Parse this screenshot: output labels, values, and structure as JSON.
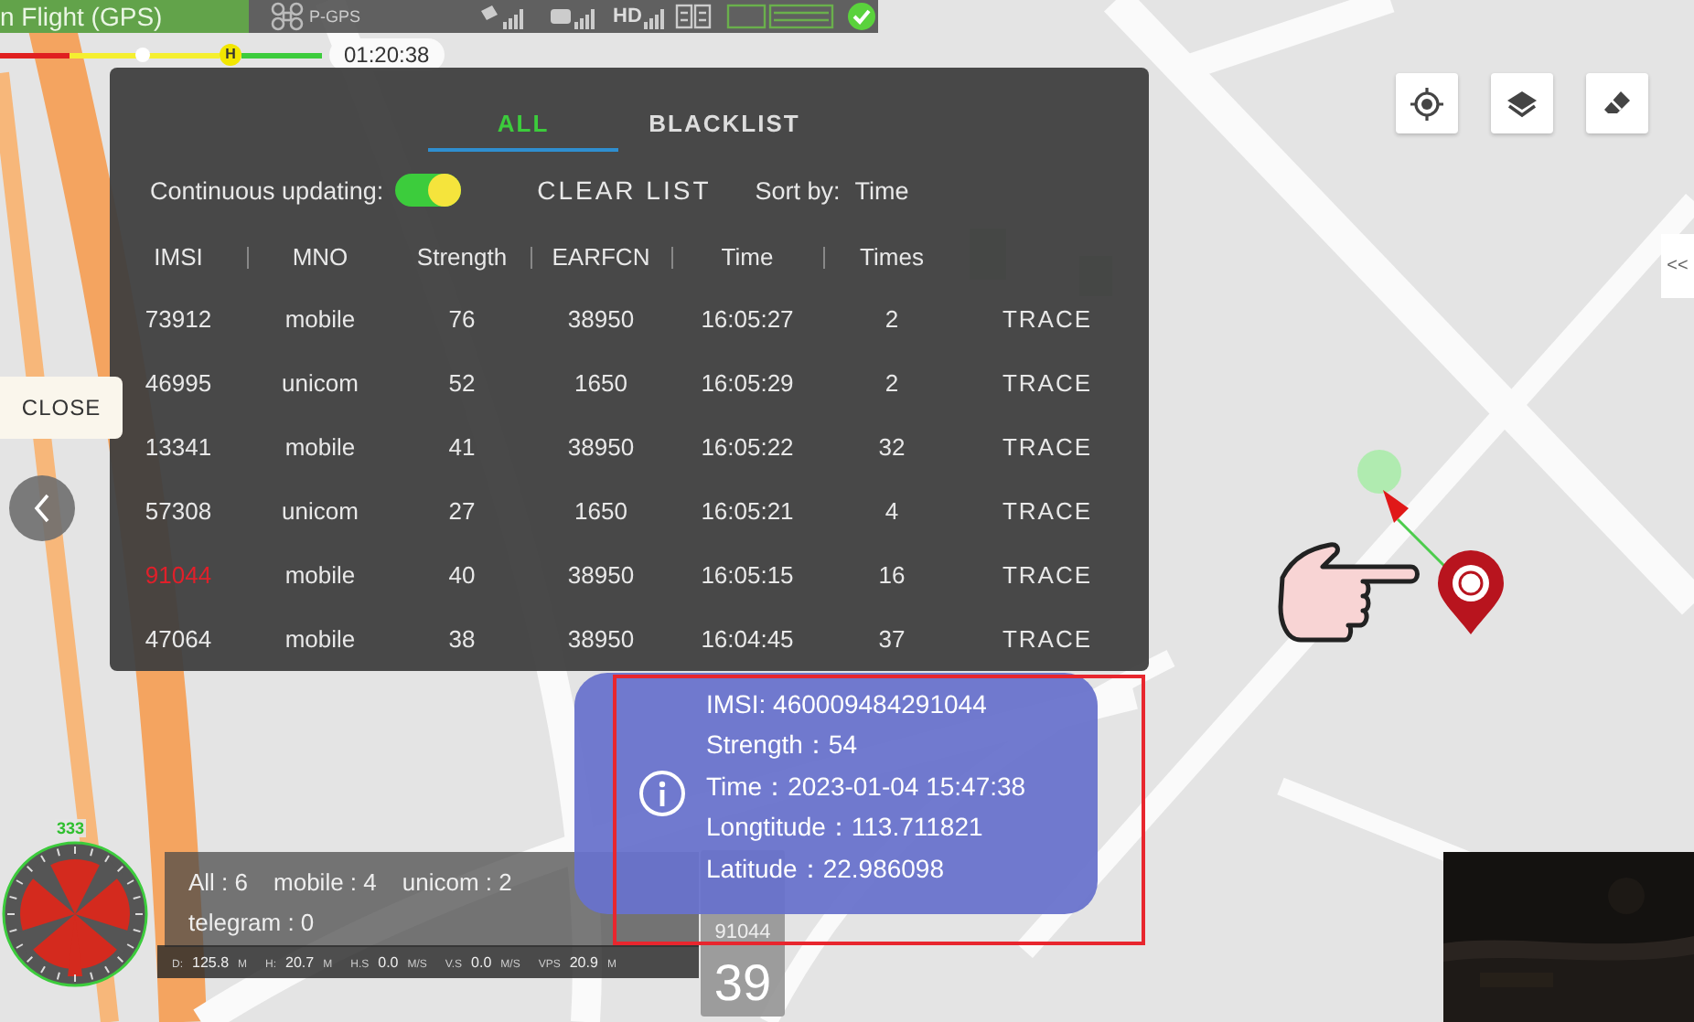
{
  "status_bar": {
    "mode": "n Flight (GPS)",
    "gps_label": "P-GPS",
    "video_label": "HD"
  },
  "flight_bar": {
    "level": 0.44,
    "home_marker": "H",
    "timer": "01:20:38"
  },
  "panel": {
    "tabs": [
      {
        "label": "ALL",
        "selected": true
      },
      {
        "label": "BLACKLIST",
        "selected": false
      }
    ],
    "continuous_label": "Continuous updating:",
    "continuous_on": true,
    "clear_button": "CLEAR LIST",
    "sort_label": "Sort by:",
    "sort_value": "Time",
    "columns": [
      "IMSI",
      "MNO",
      "Strength",
      "EARFCN",
      "Time",
      "Times"
    ],
    "rows": [
      {
        "imsi": "73912",
        "mno": "mobile",
        "strength": "76",
        "earfcn": "38950",
        "time": "16:05:27",
        "times": "2",
        "action": "TRACE",
        "flagged": false
      },
      {
        "imsi": "46995",
        "mno": "unicom",
        "strength": "52",
        "earfcn": "1650",
        "time": "16:05:29",
        "times": "2",
        "action": "TRACE",
        "flagged": false
      },
      {
        "imsi": "13341",
        "mno": "mobile",
        "strength": "41",
        "earfcn": "38950",
        "time": "16:05:22",
        "times": "32",
        "action": "TRACE",
        "flagged": false
      },
      {
        "imsi": "57308",
        "mno": "unicom",
        "strength": "27",
        "earfcn": "1650",
        "time": "16:05:21",
        "times": "4",
        "action": "TRACE",
        "flagged": false
      },
      {
        "imsi": "91044",
        "mno": "mobile",
        "strength": "40",
        "earfcn": "38950",
        "time": "16:05:15",
        "times": "16",
        "action": "TRACE",
        "flagged": true
      },
      {
        "imsi": "47064",
        "mno": "mobile",
        "strength": "38",
        "earfcn": "38950",
        "time": "16:04:45",
        "times": "37",
        "action": "TRACE",
        "flagged": false
      }
    ]
  },
  "close_button": "CLOSE",
  "expand_button": "<<",
  "info_popup": {
    "lines": [
      "IMSI: 460009484291044",
      "Strength：54",
      "Time：2023-01-04 15:47:38",
      "Longtitude：113.711821",
      "Latitude：22.986098"
    ]
  },
  "compass": {
    "heading": "333"
  },
  "counts": [
    "All : 6",
    "mobile : 4",
    "unicom : 2",
    "telegram : 0"
  ],
  "telemetry": [
    {
      "label": "D:",
      "value": "125.8",
      "unit": "M"
    },
    {
      "label": "H:",
      "value": "20.7",
      "unit": "M"
    },
    {
      "label": "H.S",
      "value": "0.0",
      "unit": "M/S"
    },
    {
      "label": "V.S",
      "value": "0.0",
      "unit": "M/S"
    },
    {
      "label": "VPS",
      "value": "20.9",
      "unit": "M"
    }
  ],
  "target_card": {
    "imsi": "91044",
    "strength": "39"
  }
}
